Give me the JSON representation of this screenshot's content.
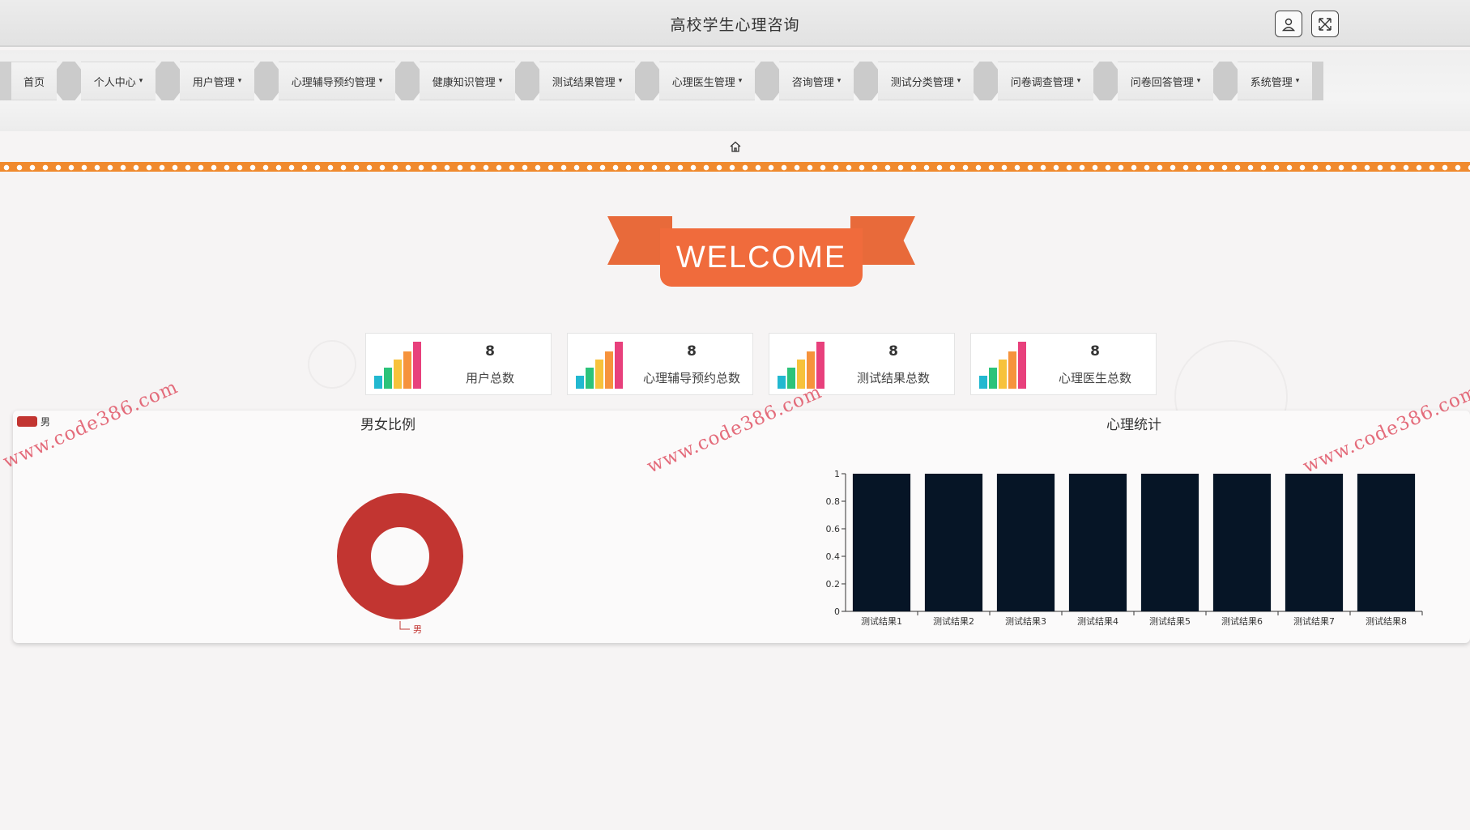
{
  "header": {
    "title": "高校学生心理咨询",
    "user_icon": "user-icon",
    "fullscreen_icon": "fullscreen-icon"
  },
  "menu": {
    "items": [
      {
        "label": "首页",
        "dropdown": false
      },
      {
        "label": "个人中心",
        "dropdown": true
      },
      {
        "label": "用户管理",
        "dropdown": true
      },
      {
        "label": "心理辅导预约管理",
        "dropdown": true
      },
      {
        "label": "健康知识管理",
        "dropdown": true
      },
      {
        "label": "测试结果管理",
        "dropdown": true
      },
      {
        "label": "心理医生管理",
        "dropdown": true
      },
      {
        "label": "咨询管理",
        "dropdown": true
      },
      {
        "label": "测试分类管理",
        "dropdown": true
      },
      {
        "label": "问卷调查管理",
        "dropdown": true
      },
      {
        "label": "问卷回答管理",
        "dropdown": true
      },
      {
        "label": "系统管理",
        "dropdown": true
      }
    ],
    "caret": "▾"
  },
  "breadcrumb": {
    "icon": "home-icon"
  },
  "welcome": {
    "text": "WELCOME"
  },
  "stats": [
    {
      "value": "8",
      "label": "用户总数"
    },
    {
      "value": "8",
      "label": "心理辅导预约总数"
    },
    {
      "value": "8",
      "label": "测试结果总数"
    },
    {
      "value": "8",
      "label": "心理医生总数"
    }
  ],
  "watermark": "www.code386.com",
  "colors": {
    "accent_orange": "#f06b3c",
    "dots_orange": "#f08a2e",
    "pie_red": "#c23531",
    "bar_navy": "#061526"
  },
  "chart_data": [
    {
      "type": "pie",
      "title": "男女比例",
      "legend": [
        "男"
      ],
      "slices": [
        {
          "name": "男",
          "value": 1
        }
      ],
      "donut": true
    },
    {
      "type": "bar",
      "title": "心理统计",
      "categories": [
        "测试结果1",
        "测试结果2",
        "测试结果3",
        "测试结果4",
        "测试结果5",
        "测试结果6",
        "测试结果7",
        "测试结果8"
      ],
      "values": [
        1,
        1,
        1,
        1,
        1,
        1,
        1,
        1
      ],
      "ylim": [
        0,
        1
      ],
      "yticks": [
        "0",
        "0.2",
        "0.4",
        "0.6",
        "0.8",
        "1"
      ]
    }
  ]
}
